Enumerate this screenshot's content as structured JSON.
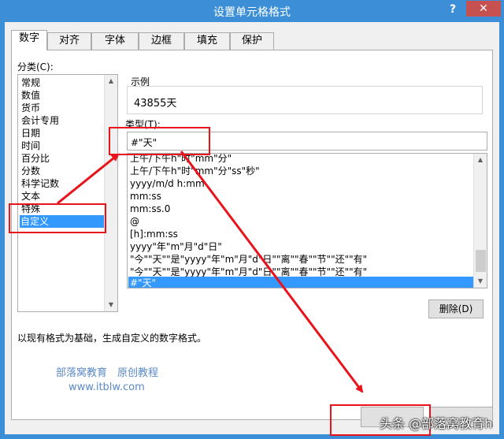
{
  "window": {
    "title": "设置单元格格式",
    "help_label": "?",
    "close_label": "✕"
  },
  "tabs": [
    {
      "label": "数字",
      "active": true
    },
    {
      "label": "对齐",
      "active": false
    },
    {
      "label": "字体",
      "active": false
    },
    {
      "label": "边框",
      "active": false
    },
    {
      "label": "填充",
      "active": false
    },
    {
      "label": "保护",
      "active": false
    }
  ],
  "category": {
    "label": "分类(C):",
    "items": [
      "常规",
      "数值",
      "货币",
      "会计专用",
      "日期",
      "时间",
      "百分比",
      "分数",
      "科学记数",
      "文本",
      "特殊",
      "自定义"
    ],
    "selected": "自定义"
  },
  "sample": {
    "label": "示例",
    "value": "43855天"
  },
  "type": {
    "label": "类型(T):",
    "value": "#\"天\""
  },
  "formats": [
    "上午/下午h\"时\"mm\"分\"",
    "上午/下午h\"时\"mm\"分\"ss\"秒\"",
    "yyyy/m/d h:mm",
    "mm:ss",
    "mm:ss.0",
    "@",
    "[h]:mm:ss",
    "yyyy\"年\"m\"月\"d\"日\"",
    "\"今\"\"天\"\"是\"yyyy\"年\"m\"月\"d\"日\"\"离\"\"春\"\"节\"\"还\"\"有\"",
    "\"今\"\"天\"\"是\"yyyy\"年\"m\"月\"d\"日\"\"离\"\"春\"\"节\"\"还\"\"有\"",
    "#\"天\""
  ],
  "selected_format": "#\"天\"",
  "delete_button": "删除(D)",
  "description": "以现有格式为基础，生成自定义的数字格式。",
  "watermark": {
    "line1": "部落窝教育　原创教程",
    "line2": "www.itblw.com"
  },
  "footer_watermark": "头条 @部落窝教育h",
  "colors": {
    "titlebar": "#3c8fd6",
    "selection": "#3399ff",
    "annotation_red": "#e8131b"
  }
}
